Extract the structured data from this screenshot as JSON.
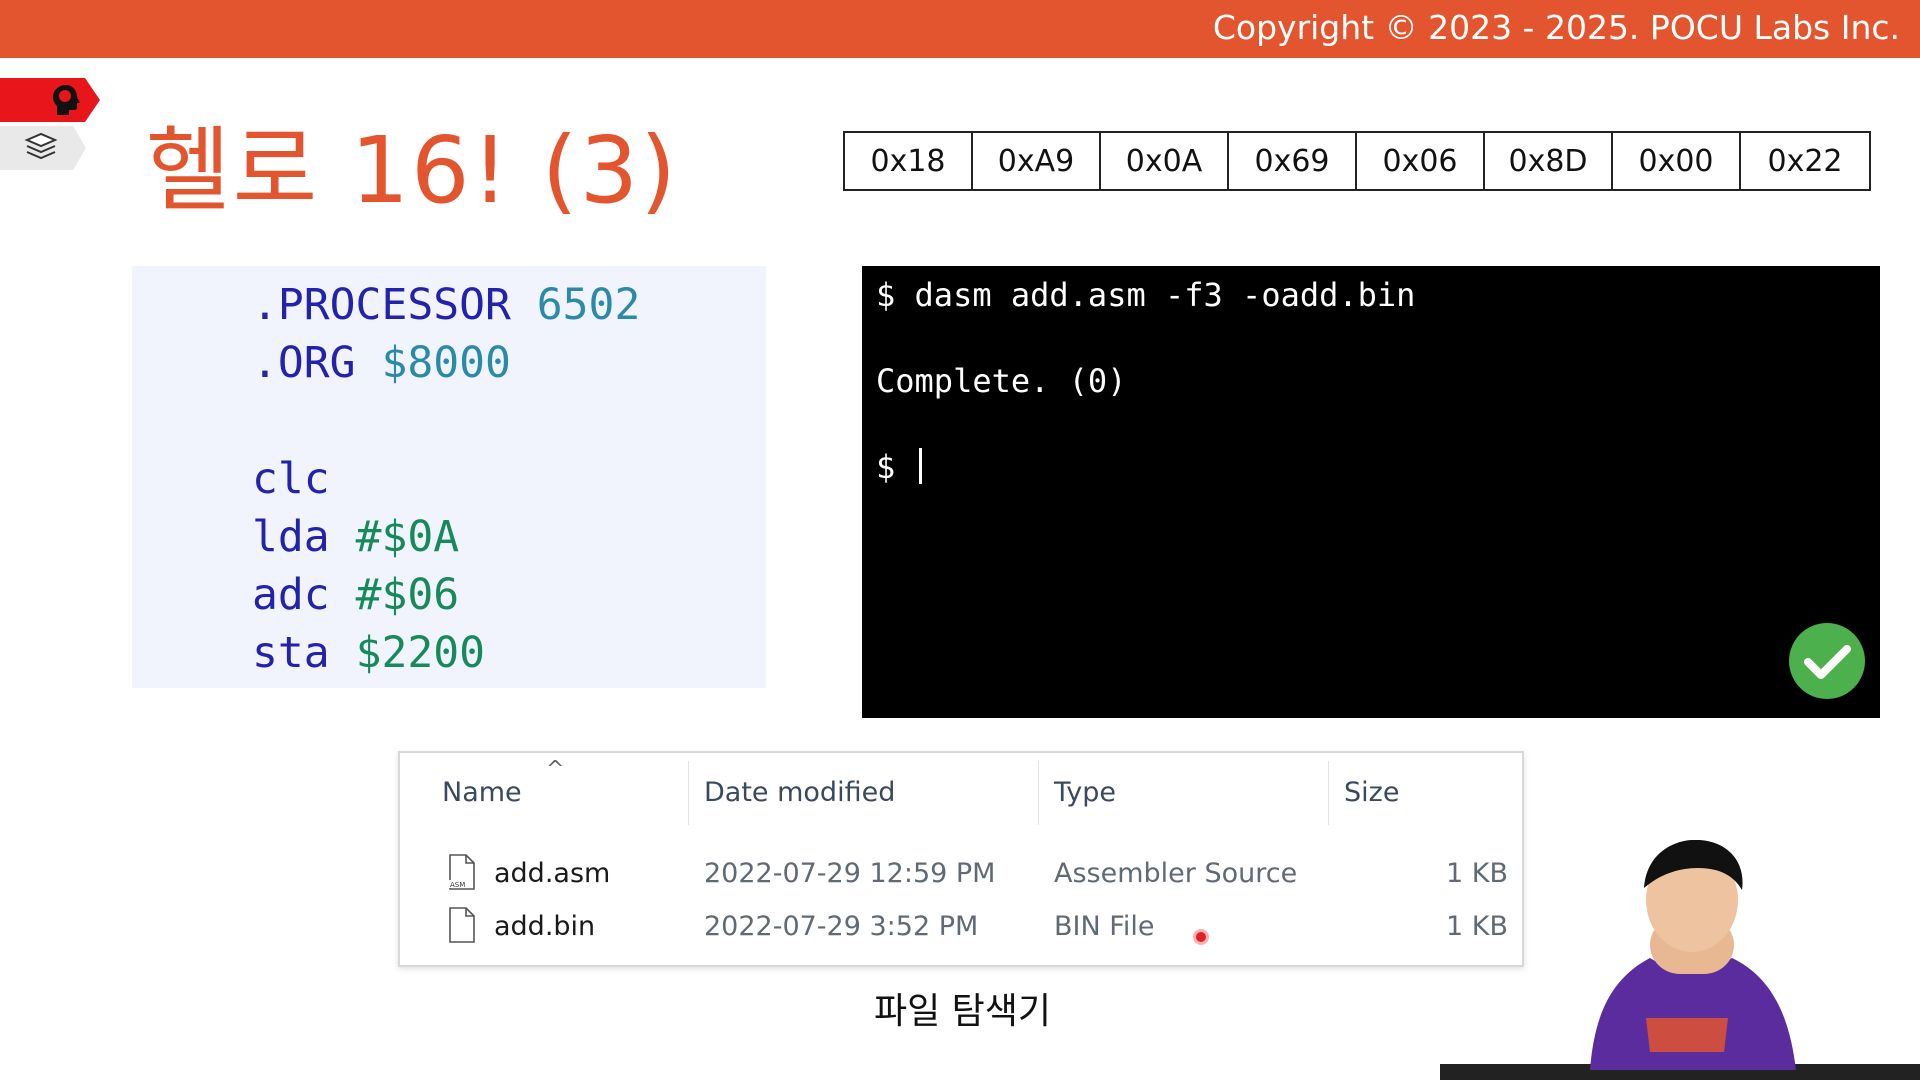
{
  "header": {
    "copyright": "Copyright © 2023 - 2025. POCU Labs Inc."
  },
  "sidebar_tabs": [
    {
      "icon": "head-icon",
      "active": true
    },
    {
      "icon": "books-icon",
      "active": false
    }
  ],
  "slide": {
    "title": "헬로 16! (3)",
    "bytes": [
      "0x18",
      "0xA9",
      "0x0A",
      "0x69",
      "0x06",
      "0x8D",
      "0x00",
      "0x22"
    ]
  },
  "code": {
    "directives": [
      {
        "kw": ".PROCESSOR",
        "val": "6502"
      },
      {
        "kw": ".ORG",
        "val": "$8000"
      }
    ],
    "instructions": [
      {
        "op": "clc",
        "arg": ""
      },
      {
        "op": "lda",
        "arg": "#$0A"
      },
      {
        "op": "adc",
        "arg": "#$06"
      },
      {
        "op": "sta",
        "arg": "$2200"
      }
    ]
  },
  "terminal": {
    "command": "$ dasm add.asm -f3 -oadd.bin",
    "output": "Complete. (0)",
    "prompt": "$",
    "status_icon": "check-circle-icon"
  },
  "explorer": {
    "columns": [
      "Name",
      "Date modified",
      "Type",
      "Size"
    ],
    "files": [
      {
        "name": "add.asm",
        "date": "2022-07-29 12:59 PM",
        "type": "Assembler Source",
        "size": "1 KB",
        "icon": "asm-file-icon"
      },
      {
        "name": "add.bin",
        "date": "2022-07-29 3:52 PM",
        "type": "BIN File",
        "size": "1 KB",
        "icon": "blank-file-icon"
      }
    ],
    "caption": "파일 탐색기"
  },
  "colors": {
    "accent": "#e2552f",
    "code_keyword": "#2222aa",
    "code_number": "#2a8aa8",
    "code_arg": "#168a5a",
    "terminal_bg": "#000000",
    "check": "#4cb04c"
  }
}
